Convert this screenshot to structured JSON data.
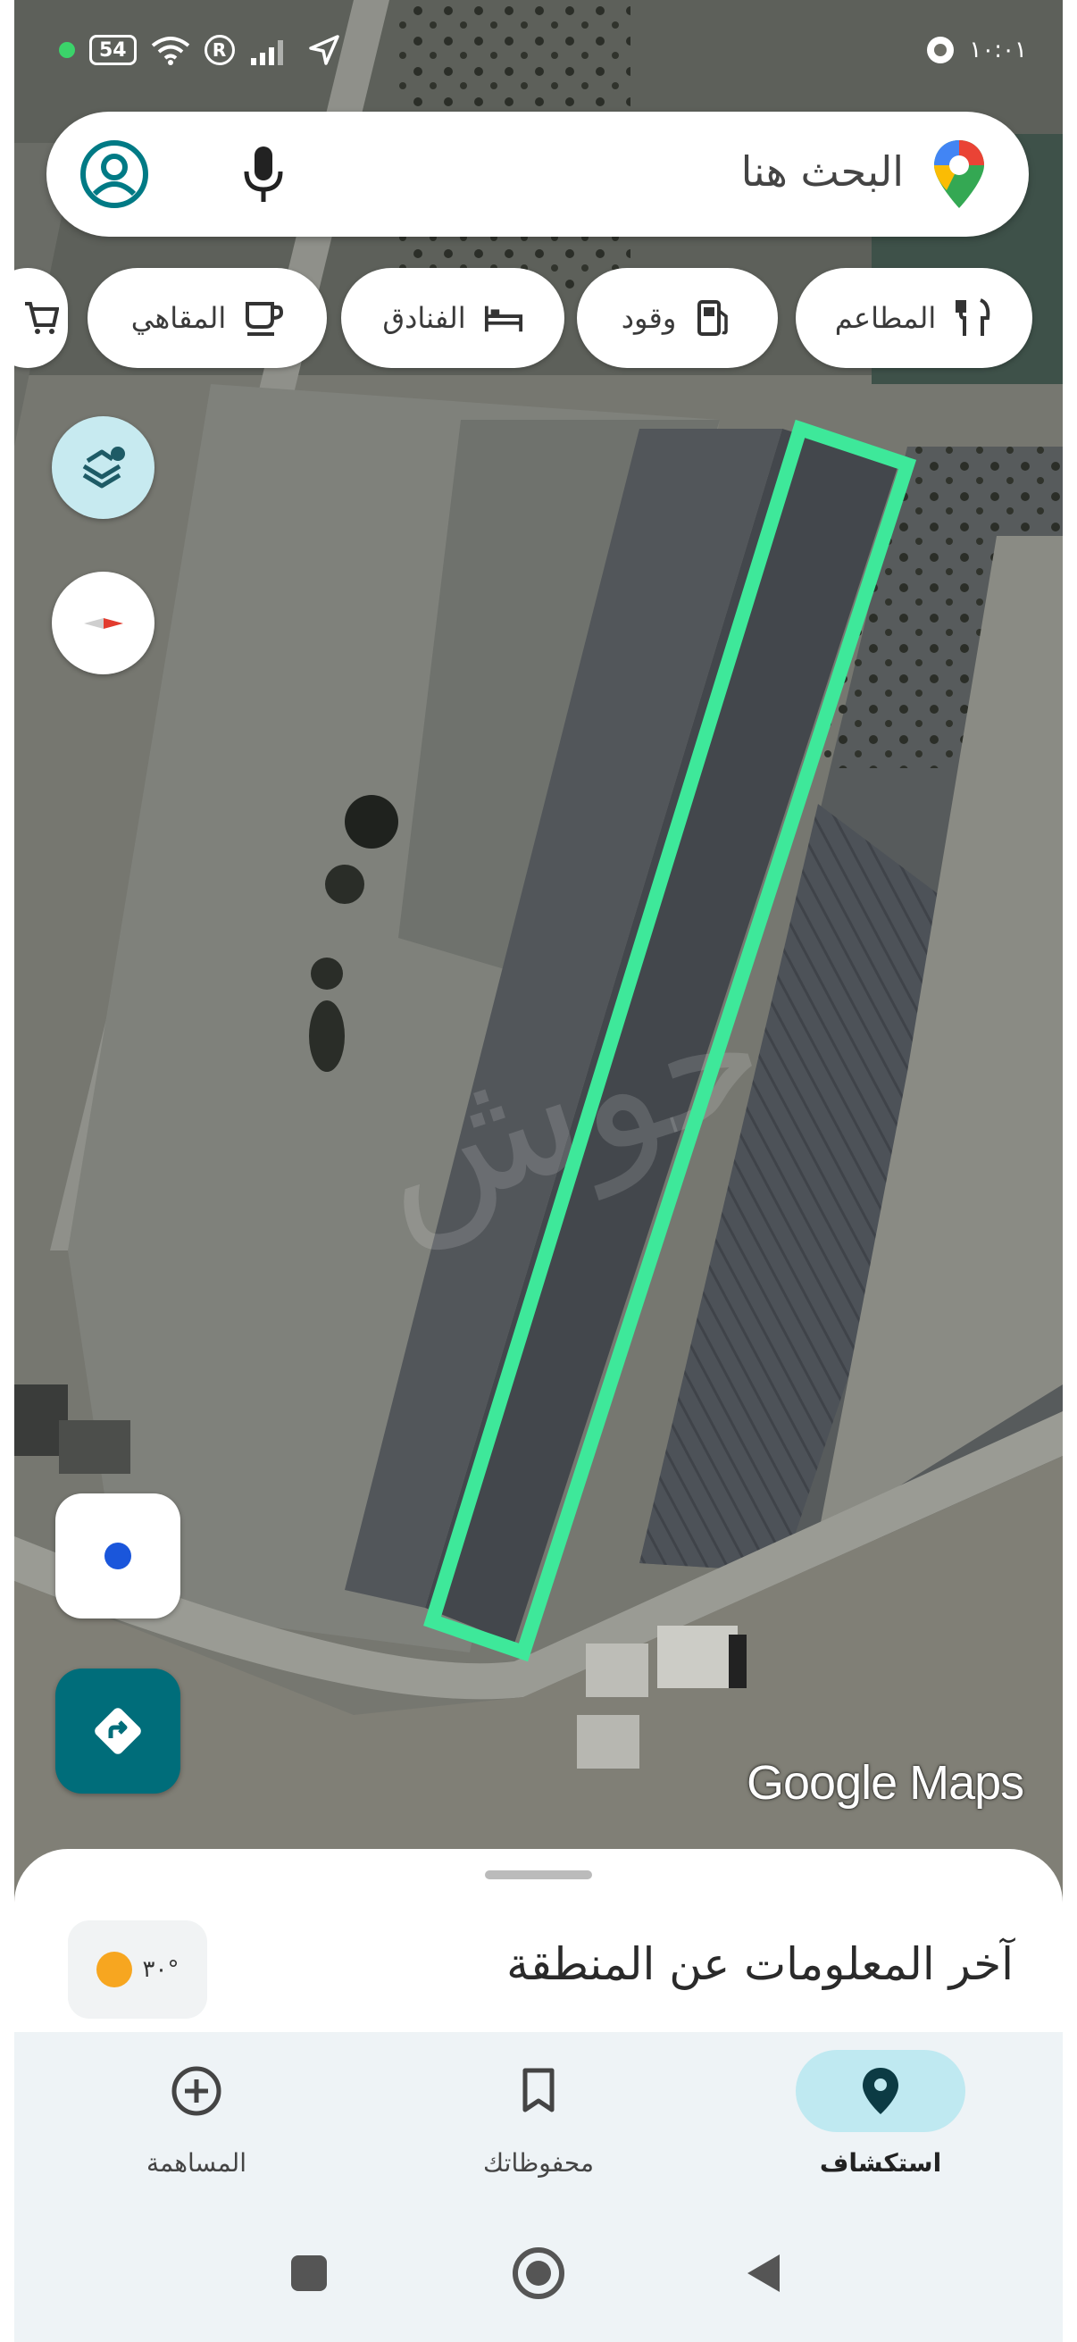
{
  "status_bar": {
    "battery": "54",
    "time": "١٠:٠١"
  },
  "search": {
    "placeholder": "البحث هنا"
  },
  "chips": [
    {
      "label": "المطاعم",
      "icon": "utensils-icon"
    },
    {
      "label": "وقود",
      "icon": "fuel-pump-icon"
    },
    {
      "label": "الفنادق",
      "icon": "bed-icon"
    },
    {
      "label": "المقاهي",
      "icon": "coffee-cup-icon"
    },
    {
      "label": "",
      "icon": "shopping-cart-icon"
    }
  ],
  "map": {
    "attribution": "Google Maps",
    "highlight_color": "#3ee89a"
  },
  "sheet": {
    "title": "آخر المعلومات عن المنطقة",
    "temperature": "٣٠°"
  },
  "nav": {
    "items": [
      {
        "label": "استكشاف",
        "icon": "location-pin-icon",
        "active": true
      },
      {
        "label": "محفوظاتك",
        "icon": "bookmark-icon",
        "active": false
      },
      {
        "label": "المساهمة",
        "icon": "plus-circle-icon",
        "active": false
      }
    ]
  },
  "colors": {
    "accent_teal": "#006d7a",
    "active_pill": "#bfe9f1"
  }
}
